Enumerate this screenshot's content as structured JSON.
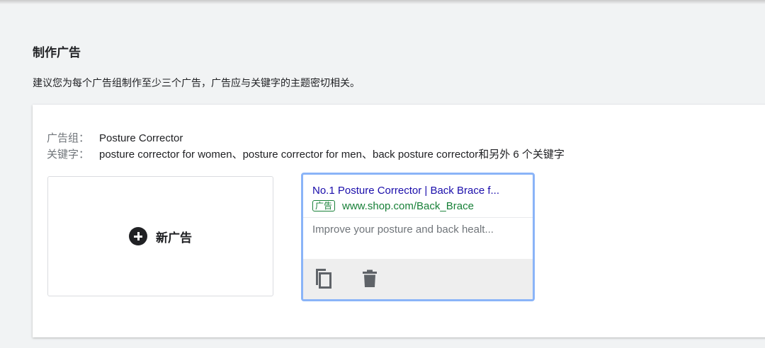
{
  "section": {
    "title": "制作广告",
    "description": "建议您为每个广告组制作至少三个广告，广告应与关键字的主题密切相关。"
  },
  "ad_group": {
    "group_label": "广告组：",
    "group_value": "Posture Corrector",
    "keywords_label": "关键字：",
    "keywords_value": "posture corrector for women、posture corrector for men、back posture corrector和另外 6 个关键字"
  },
  "new_ad": {
    "label": "新广告",
    "icon": "add-circle-icon"
  },
  "ad_preview": {
    "headline": "No.1 Posture Corrector | Back Brace f...",
    "badge": "广告",
    "display_url": "www.shop.com/Back_Brace",
    "description": "Improve your posture and back healt...",
    "actions": [
      "copy-icon",
      "delete-icon"
    ]
  },
  "colors": {
    "headline": "#1a0dab",
    "url": "#188038",
    "selected_border": "#8ab4f8"
  }
}
